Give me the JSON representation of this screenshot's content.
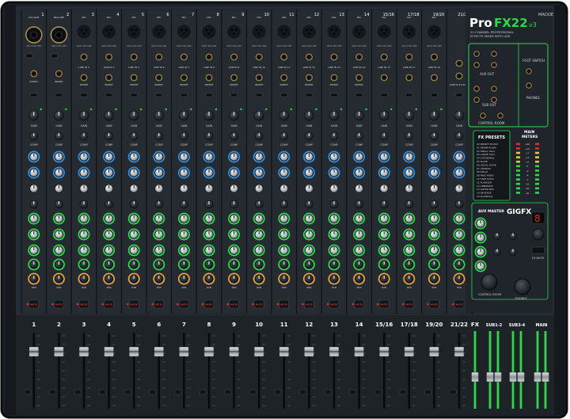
{
  "brand": {
    "logo_word": "Pro",
    "logo_model": "FX22",
    "logo_suffix": "v3",
    "subtitle_line1": "22-CHANNEL PROFESSIONAL",
    "subtitle_line2": "EFFECTS MIXER WITH USB",
    "logo_mark": "MACKIE"
  },
  "colors": {
    "chassis": "#1d2228",
    "panel": "#262c33",
    "accent_green": "#2bd94a",
    "aux_blue": "#2f8fe0",
    "knob_gray": "#cfd3d6",
    "mute_red": "#d6312b",
    "pan_orange": "#e8a13a"
  },
  "channels": [
    {
      "num": "1",
      "top": "1",
      "mic": "MIC/LINE",
      "pre": "ONYX MIC PRE",
      "line": "",
      "type": "combo"
    },
    {
      "num": "2",
      "top": "2",
      "mic": "MIC/LINE",
      "pre": "ONYX MIC PRE",
      "line": "",
      "type": "combo"
    },
    {
      "num": "3",
      "top": "3",
      "mic": "MIC",
      "pre": "ONYX MIC PRE",
      "line": "LINE IN 3",
      "type": "xlr"
    },
    {
      "num": "4",
      "top": "4",
      "mic": "MIC",
      "pre": "ONYX MIC PRE",
      "line": "LINE IN 4",
      "type": "xlr"
    },
    {
      "num": "5",
      "top": "5",
      "mic": "MIC",
      "pre": "ONYX MIC PRE",
      "line": "LINE IN 5",
      "type": "xlr"
    },
    {
      "num": "6",
      "top": "6",
      "mic": "MIC",
      "pre": "ONYX MIC PRE",
      "line": "LINE IN 6",
      "type": "xlr"
    },
    {
      "num": "7",
      "top": "7",
      "mic": "MIC",
      "pre": "ONYX MIC PRE",
      "line": "LINE IN 7",
      "type": "xlr"
    },
    {
      "num": "8",
      "top": "8",
      "mic": "MIC",
      "pre": "ONYX MIC PRE",
      "line": "LINE IN 8",
      "type": "xlr"
    },
    {
      "num": "9",
      "top": "9",
      "mic": "MIC",
      "pre": "ONYX MIC PRE",
      "line": "LINE IN 9",
      "type": "xlr"
    },
    {
      "num": "10",
      "top": "10",
      "mic": "MIC",
      "pre": "ONYX MIC PRE",
      "line": "LINE IN 10",
      "type": "xlr"
    },
    {
      "num": "11",
      "top": "11",
      "mic": "MIC",
      "pre": "ONYX MIC PRE",
      "line": "LINE IN 11",
      "type": "xlr"
    },
    {
      "num": "12",
      "top": "12",
      "mic": "MIC",
      "pre": "ONYX MIC PRE",
      "line": "LINE IN 12",
      "type": "xlr"
    },
    {
      "num": "13",
      "top": "13",
      "mic": "MIC",
      "pre": "ONYX MIC PRE",
      "line": "LINE IN 13",
      "type": "xlr"
    },
    {
      "num": "14",
      "top": "14",
      "mic": "MIC",
      "pre": "ONYX MIC PRE",
      "line": "LINE IN 14",
      "type": "xlr"
    },
    {
      "num": "15/16",
      "top": "15/16",
      "mic": "MIC",
      "pre": "ONYX MIC PRE",
      "line": "LINE IN 15",
      "type": "stereo"
    },
    {
      "num": "17/18",
      "top": "17/18",
      "mic": "MIC",
      "pre": "ONYX MIC PRE",
      "line": "LINE IN 17",
      "type": "stereo"
    },
    {
      "num": "19/20",
      "top": "19/20",
      "mic": "MIC",
      "pre": "ONYX MIC PRE",
      "line": "LINE IN 19",
      "type": "stereo"
    },
    {
      "num": "21/22",
      "top": "21/22",
      "mic": "",
      "pre": "",
      "line": "LINE IN 21/22",
      "type": "line"
    }
  ],
  "strip_labels": {
    "insert": "INSERT",
    "gain": "GAIN",
    "comp": "COMP",
    "mute": "MUTE",
    "hi": "HI",
    "mid": "MID",
    "low": "LOW",
    "pan": "PAN",
    "solo": "SOLO"
  },
  "right_panel": {
    "aux_out": "AUX OUT",
    "foot_switch": "FOOT SWITCH",
    "sub_out": "SUB OUT",
    "phones": "PHONES",
    "control_room": "CONTROL ROOM",
    "fx_presets_title": "FX PRESETS",
    "fx_presets": [
      "BRIGHT ROOM",
      "WARM ROOM",
      "SMALL HALL",
      "LARGE HALL",
      "CATHEDRAL",
      "PLATE",
      "VOCAL PLATE",
      "CHORUS",
      "DELAY",
      "PING PONG",
      "TAPE ECHO",
      "FLANGER",
      "AMBIENCE",
      "GATED REV",
      "REVERSE",
      "SLAPBACK"
    ],
    "main_meters_line1": "MAIN",
    "main_meters_line2": "METERS",
    "meter_scale": [
      "+20",
      "+10",
      "+7",
      "+4",
      "+2",
      "0",
      "-2",
      "-4",
      "-7",
      "-10",
      "-20",
      "-30"
    ],
    "gigfx": "GIGFX",
    "aux_master": "AUX MASTER",
    "display_value": "8",
    "fx_mute": "FX MUTE",
    "control_room_knob": "CONTROL ROOM",
    "phones_knob": "PHONES"
  },
  "bottom_labels": {
    "fx": "FX",
    "sub12": "SUB1-2",
    "sub34": "SUB3-4",
    "main": "MAIN"
  }
}
